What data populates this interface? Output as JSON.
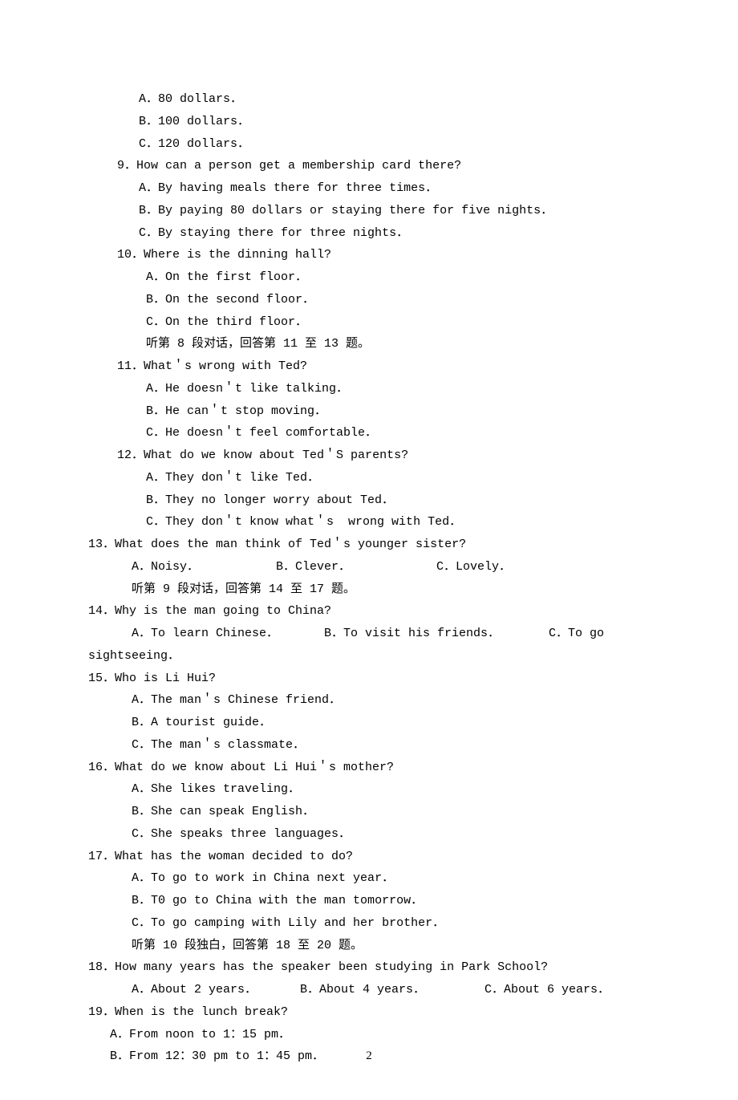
{
  "q8_opts": {
    "a": "A．80 dollars．",
    "b": "B．100 dollars．",
    "c": "C．120 dollars．"
  },
  "q9": {
    "stem": "9．How can a person get a membership card there?",
    "a": "A．By having meals there for three times．",
    "b": "B．By paying 80 dollars or staying there for five nights．",
    "c": "C．By staying there for three nights．"
  },
  "q10": {
    "stem": "10．Where is the dinning hall?",
    "a": "A．On the first floor．",
    "b": "B．On the second floor．",
    "c": "C．On the third floor．",
    "note": "听第 8 段对话，回答第 11 至 13 题。"
  },
  "q11": {
    "stem": "11．What＇s wrong with Ted?",
    "a": "A．He doesn＇t like talking．",
    "b": "B．He can＇t stop moving．",
    "c": "C．He doesn＇t feel comfortable．"
  },
  "q12": {
    "stem": "12．What do we know about Ted＇S parents?",
    "a": "A．They don＇t like Ted．",
    "b": "B．They no longer worry about Ted．",
    "c": "C．They don＇t know what＇s  wrong with Ted．"
  },
  "q13": {
    "stem": "13．What does the man think of Ted＇s younger sister?",
    "a": "A．Noisy．",
    "b": "B．Clever．",
    "c": "C．Lovely．",
    "note": "听第 9 段对话，回答第 14 至 17 题。"
  },
  "q14": {
    "stem": "14．Why is the man going to China?",
    "a": "A．To learn Chinese．",
    "b": "B．To visit his friends．",
    "c": "C．To go",
    "c2": "sightseeing．"
  },
  "q15": {
    "stem": "15．Who is Li Hui?",
    "a": "A．The man＇s Chinese friend．",
    "b": "B．A tourist guide．",
    "c": "C．The man＇s classmate．"
  },
  "q16": {
    "stem": "16．What do we know about Li Hui＇s mother?",
    "a": "A．She likes traveling．",
    "b": "B．She can speak English．",
    "c": "C．She speaks three languages．"
  },
  "q17": {
    "stem": "17．What has the woman decided to do?",
    "a": "A．To go to work in China next year．",
    "b": "B．T0 go to China with the man tomorrow．",
    "c": "C．To go camping with Lily and her brother．",
    "note": "听第 10 段独白，回答第 18 至 20 题。"
  },
  "q18": {
    "stem": "18．How many years has the speaker been studying in Park School?",
    "a": "A．About 2 years．",
    "b": "B．About 4 years．",
    "c": "C．About 6 years．"
  },
  "q19": {
    "stem": "19．When is the lunch break?",
    "a": "A．From noon to 1：15 pm．",
    "b": "B．From 12：30 pm to 1：45 pm．"
  },
  "page_number": "2"
}
